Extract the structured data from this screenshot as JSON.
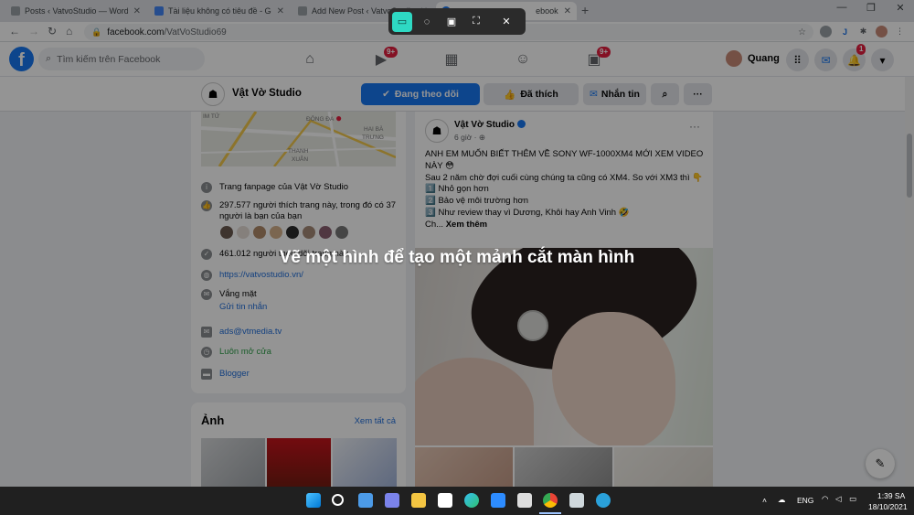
{
  "browser": {
    "tabs": [
      {
        "title": "Posts ‹ VatvoStudio — WordPress",
        "color": "#9aa0a6",
        "active": false
      },
      {
        "title": "Tài liệu không có tiêu đề - Google",
        "color": "#4285f4",
        "active": false
      },
      {
        "title": "Add New Post ‹ VatvoStudio",
        "color": "#9aa0a6",
        "active": false
      },
      {
        "title": "ebook",
        "color": "#1877f2",
        "active": true
      }
    ],
    "new_tab": "+",
    "window_controls": {
      "minimize": "—",
      "maximize": "❐",
      "close": "✕"
    },
    "url_host": "facebook.com",
    "url_path": "/VatVoStudio69",
    "nav_icons": {
      "back": "←",
      "forward": "→",
      "reload": "↻",
      "home": "⌂"
    }
  },
  "facebook": {
    "logo": "f",
    "search_placeholder": "Tìm kiếm trên Facebook",
    "nav": [
      {
        "icon": "home-icon",
        "glyph": "⌂"
      },
      {
        "icon": "watch-icon",
        "glyph": "▶",
        "badge": "9+"
      },
      {
        "icon": "marketplace-icon",
        "glyph": "▦"
      },
      {
        "icon": "groups-icon",
        "glyph": "☺"
      },
      {
        "icon": "gaming-icon",
        "glyph": "▣",
        "badge": "9+"
      }
    ],
    "profile_name": "Quang",
    "notification_count": "1",
    "accent": "#1877f2"
  },
  "page": {
    "name": "Vật Vờ Studio",
    "follow_label": "Đang theo dõi",
    "like_label": "Đã thích",
    "message_label": "Nhắn tin",
    "more": "···"
  },
  "about": {
    "map_labels": [
      "IM TỬ",
      "ĐÔNG ĐA",
      "HAI BÀ",
      "TRƯNG",
      "THANH",
      "XUÂN"
    ],
    "description": "Trang fanpage của Vật Vờ Studio",
    "likes": "297.577 người thích trang này, trong đó có 37 người là bạn của bạn",
    "followers": "461.012 người theo dõi trang này",
    "website": "https://vatvostudio.vn/",
    "status": "Vắng mặt",
    "send_message": "Gửi tin nhắn",
    "email": "ads@vtmedia.tv",
    "hours": "Luôn mở cửa",
    "category": "Blogger"
  },
  "photos": {
    "title": "Ảnh",
    "see_all": "Xem tất cả"
  },
  "post": {
    "author": "Vật Vờ Studio",
    "time": "6 giờ · ⊕",
    "line1": "ANH EM MUỐN BIẾT THÊM VỀ SONY WF-1000XM4 MỚI XEM VIDEO NÀY 😳",
    "line2": "Sau 2 năm chờ đợi cuối cùng chúng ta cũng có XM4. So với XM3 thì 👇",
    "item1": "1️⃣ Nhỏ gọn hơn",
    "item2": "2️⃣ Bảo vệ môi trường hơn",
    "item3": "3️⃣ Như review thay vì Dương, Khôi hay Anh Vinh 🤣",
    "truncated": "Ch...",
    "see_more": "Xem thêm",
    "more": "···"
  },
  "snip": {
    "hint": "Vẽ một hình để tạo một mảnh cắt màn hình",
    "modes": [
      {
        "name": "rectangular-snip-icon",
        "glyph": "▭",
        "selected": true
      },
      {
        "name": "freeform-snip-icon",
        "glyph": "◌",
        "selected": false
      },
      {
        "name": "window-snip-icon",
        "glyph": "▣",
        "selected": false
      },
      {
        "name": "fullscreen-snip-icon",
        "glyph": "⛶",
        "selected": false
      }
    ],
    "close": "✕",
    "highlight": "#2ed9c3"
  },
  "taskbar": {
    "language": "ENG",
    "time": "1:39 SA",
    "date": "18/10/2021"
  }
}
